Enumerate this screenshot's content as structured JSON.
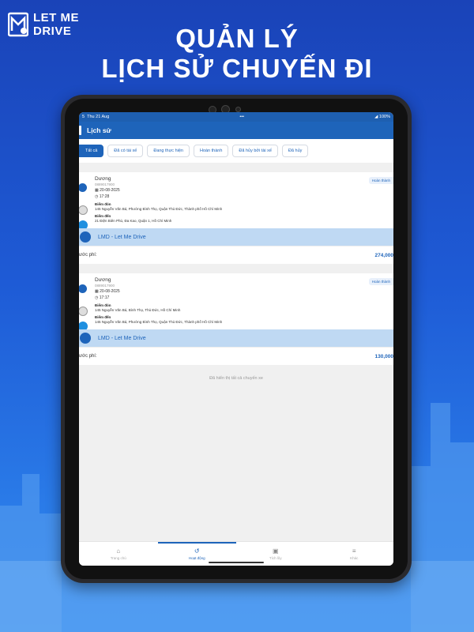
{
  "brand": {
    "line1": "LET ME",
    "line2": "DRIVE"
  },
  "headline": {
    "line1": "QUẢN LÝ",
    "line2": "LỊCH SỬ CHUYẾN ĐI"
  },
  "status": {
    "time": "5",
    "date": "Thu 21 Aug",
    "battery": "100%"
  },
  "navbar": {
    "title": "Lịch sử"
  },
  "tabs": [
    {
      "label": "Tất cả",
      "active": true
    },
    {
      "label": "Đã có tài xế"
    },
    {
      "label": "Đang thực hiện"
    },
    {
      "label": "Hoàn thành"
    },
    {
      "label": "Đã hủy bởi tài xế"
    },
    {
      "label": "Đã hủy"
    }
  ],
  "trips": [
    {
      "name": "Dương",
      "phone": "0889017900",
      "date": "20-08-2025",
      "time": "17:28",
      "status": "Hoàn thành",
      "pickup_label": "Điểm đón",
      "pickup": "145 Nguyễn Văn Bá, Phường Bình Thọ, Quận Thủ Đức, Thành phố Hồ Chí Minh",
      "dropoff_label": "Điểm đến",
      "dropoff": "21 Điện Biên Phủ, Đa Kao, Quận 1, Hồ Chí Minh",
      "provider": "LMD - Let Me Drive",
      "fee_label": "ước phí:",
      "fee": "274,000"
    },
    {
      "name": "Dương",
      "phone": "0889017900",
      "date": "20-08-2025",
      "time": "17:17",
      "status": "Hoàn thành",
      "pickup_label": "Điểm đón",
      "pickup": "145 Nguyễn Văn Bá, Bình Thọ, Thủ Đức, Hồ Chí Minh",
      "dropoff_label": "Điểm đến",
      "dropoff": "145 Nguyễn Văn Bá, Phường Bình Thọ, Quận Thủ Đức, Thành phố Hồ Chí Minh",
      "provider": "LMD - Let Me Drive",
      "fee_label": "ước phí:",
      "fee": "130,000"
    }
  ],
  "end_note": "Đã hiển thị tất cả chuyến xe",
  "bottom_nav": [
    {
      "label": "Trang chủ",
      "icon": "home-icon"
    },
    {
      "label": "Hoạt động",
      "icon": "history-icon",
      "active": true
    },
    {
      "label": "Tích lũy",
      "icon": "gift-icon"
    },
    {
      "label": "Khác",
      "icon": "menu-icon"
    }
  ],
  "colors": {
    "primary": "#1E64BA",
    "background": "#1E4FC4"
  }
}
